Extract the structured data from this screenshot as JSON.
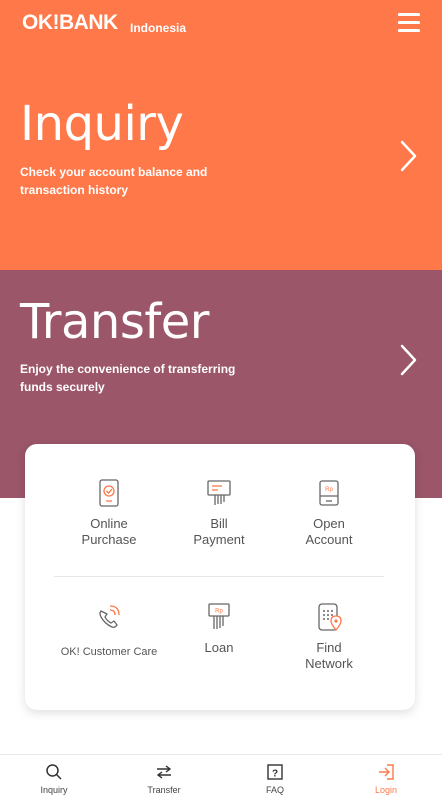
{
  "header": {
    "logo_text": "OK!BANK",
    "logo_sub": "Indonesia",
    "menu_icon": "hamburger-icon"
  },
  "hero": {
    "inquiry": {
      "title": "Inquiry",
      "description": "Check your account balance and transaction history",
      "color": "#ff7849"
    },
    "transfer": {
      "title": "Transfer",
      "description": "Enjoy the convenience of transferring funds securely",
      "color": "#9b5669"
    }
  },
  "services": [
    {
      "line1": "Online",
      "line2": "Purchase",
      "icon": "online-purchase-icon"
    },
    {
      "line1": "Bill",
      "line2": "Payment",
      "icon": "bill-payment-icon"
    },
    {
      "line1": "Open",
      "line2": "Account",
      "icon": "open-account-icon"
    },
    {
      "line1": "OK! Customer Care",
      "line2": "",
      "icon": "customer-care-icon"
    },
    {
      "line1": "Loan",
      "line2": "",
      "icon": "loan-icon"
    },
    {
      "line1": "Find",
      "line2": "Network",
      "icon": "find-network-icon"
    }
  ],
  "bottom_nav": [
    {
      "label": "Inquiry",
      "icon": "search-icon"
    },
    {
      "label": "Transfer",
      "icon": "transfer-arrows-icon"
    },
    {
      "label": "FAQ",
      "icon": "question-icon"
    },
    {
      "label": "Login",
      "icon": "login-icon",
      "active": true
    }
  ],
  "colors": {
    "accent": "#ff7849",
    "secondary": "#9b5669"
  }
}
